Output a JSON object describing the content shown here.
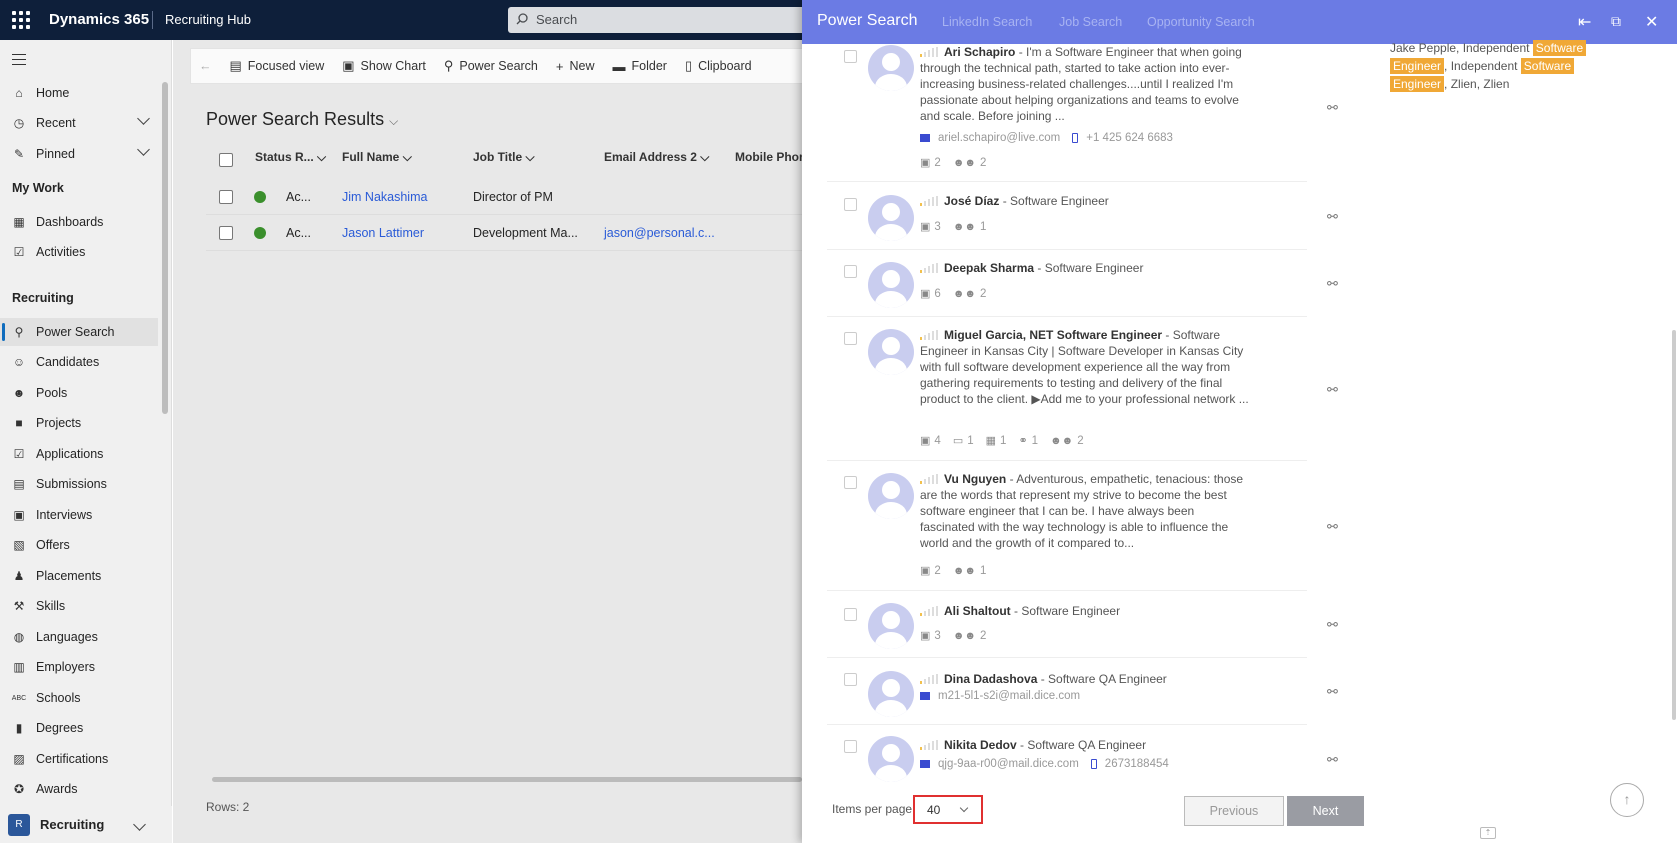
{
  "topbar": {
    "brand": "Dynamics 365",
    "hub": "Recruiting Hub",
    "search_placeholder": "Search"
  },
  "sidebar": {
    "items": [
      {
        "label": "Home"
      },
      {
        "label": "Recent"
      },
      {
        "label": "Pinned"
      }
    ],
    "my_work_heading": "My Work",
    "my_work": [
      {
        "label": "Dashboards"
      },
      {
        "label": "Activities"
      }
    ],
    "recruiting_heading": "Recruiting",
    "recruiting": [
      {
        "label": "Power Search"
      },
      {
        "label": "Candidates"
      },
      {
        "label": "Pools"
      },
      {
        "label": "Projects"
      },
      {
        "label": "Applications"
      },
      {
        "label": "Submissions"
      },
      {
        "label": "Interviews"
      },
      {
        "label": "Offers"
      },
      {
        "label": "Placements"
      },
      {
        "label": "Skills"
      },
      {
        "label": "Languages"
      },
      {
        "label": "Employers"
      },
      {
        "label": "Schools"
      },
      {
        "label": "Degrees"
      },
      {
        "label": "Certifications"
      },
      {
        "label": "Awards"
      }
    ],
    "area": {
      "badge": "R",
      "label": "Recruiting"
    }
  },
  "commandbar": {
    "focused": "Focused view",
    "chart": "Show Chart",
    "power": "Power Search",
    "new": "New",
    "folder": "Folder",
    "clipboard": "Clipboard"
  },
  "results": {
    "title": "Power Search Results",
    "columns": [
      "Status R...",
      "Full Name",
      "Job Title",
      "Email Address 2",
      "Mobile Phon"
    ],
    "rows": [
      {
        "status": "Ac...",
        "name": "Jim Nakashima",
        "job": "Director of PM",
        "email": ""
      },
      {
        "status": "Ac...",
        "name": "Jason Lattimer",
        "job": "Development Ma...",
        "email": "jason@personal.c..."
      }
    ],
    "rows_count": "Rows: 2"
  },
  "panel": {
    "tabs": {
      "active": "Power Search",
      "linkedin": "LinkedIn Search",
      "job": "Job Search",
      "opportunity": "Opportunity Search"
    },
    "candidates": [
      {
        "name": "Ari Schapiro",
        "desc": "I'm a Software Engineer that when going through the technical path, started to take action into ever-increasing business-related challenges....until I realized I'm passionate about helping organizations and teams to evolve and scale. Before joining ...",
        "email": "ariel.schapiro@live.com",
        "phone": "+1 425 624 6683",
        "c1": "2",
        "c2": "2"
      },
      {
        "name": "José Díaz",
        "desc": "Software Engineer",
        "c1": "3",
        "c2": "1"
      },
      {
        "name": "Deepak Sharma",
        "desc": "Software Engineer",
        "c1": "6",
        "c2": "2"
      },
      {
        "name": "Miguel Garcia, NET Software Engineer",
        "desc": "Software Engineer in Kansas City | Software Developer in Kansas City with full software development experience all the way from gathering requirements to testing and delivery of the final product to the client. ▶Add me to your professional network ...",
        "c1": "4",
        "c2": "1",
        "c3": "1",
        "c4": "1",
        "c5": "2"
      },
      {
        "name": "Vu Nguyen",
        "desc": "Adventurous, empathetic, tenacious: those are the words that represent my strive to become the best software engineer that I can be. I have always been fascinated with the way technology is able to influence the world and the growth of it compared to...",
        "c1": "2",
        "c2": "1"
      },
      {
        "name": "Ali Shaltout",
        "desc": "Software Engineer",
        "c1": "3",
        "c2": "2"
      },
      {
        "name": "Dina Dadashova",
        "desc": "Software QA Engineer",
        "email": "m21-5l1-s2i@mail.dice.com"
      },
      {
        "name": "Nikita Dedov",
        "desc": "Software QA Engineer",
        "email": "qjg-9aa-r00@mail.dice.com",
        "phone": "2673188454"
      }
    ],
    "tags": {
      "t0": "Jake Pepple, Independent",
      "tag1": "Software",
      "tag2": "Engineer",
      "t1": ", Independent",
      "tag3": "Software",
      "tag4": "Engineer",
      "t2": ", Zlien, Zlien"
    },
    "pager": {
      "label": "Items per page",
      "value": "40",
      "prev": "Previous",
      "next": "Next"
    }
  }
}
